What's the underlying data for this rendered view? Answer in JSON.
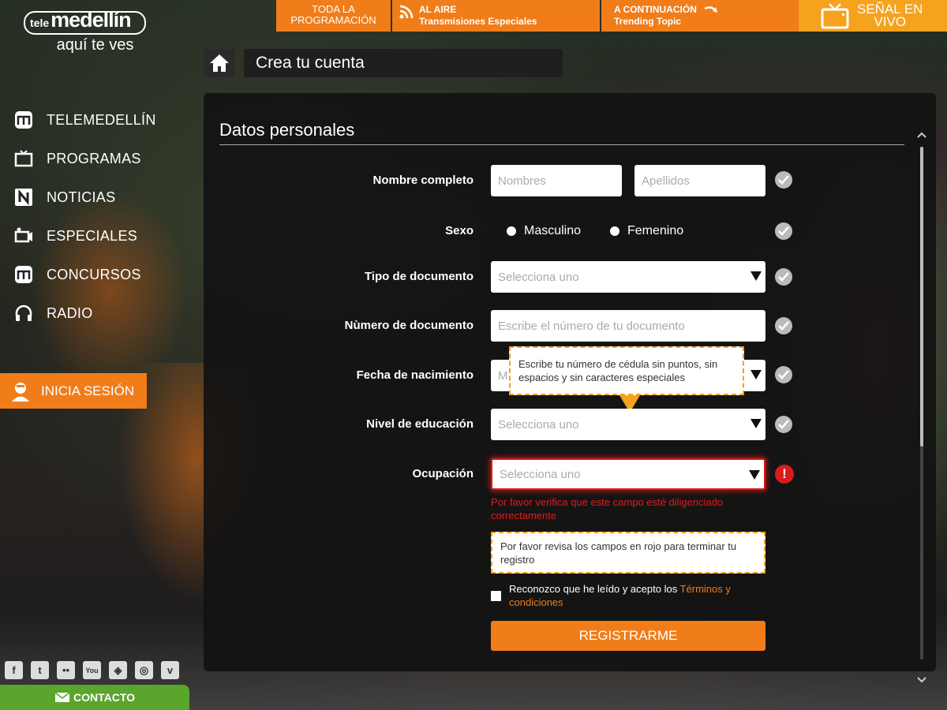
{
  "logo": {
    "tele": "tele",
    "brand": "medellín",
    "tagline": "aquí te ves"
  },
  "topbar": {
    "programacion": "TODA LA PROGRAMACIÓN",
    "aire_title": "AL AIRE",
    "aire_sub": "Transmisiones Especiales",
    "cont_title": "A CONTINUACIÓN",
    "cont_sub": "Trending Topic",
    "senal_line1": "SEÑAL EN",
    "senal_line2": "VIVO"
  },
  "nav": {
    "items": [
      {
        "label": "TELEMEDELLÍN",
        "icon": "m-logo-icon"
      },
      {
        "label": "PROGRAMAS",
        "icon": "tv-icon"
      },
      {
        "label": "NOTICIAS",
        "icon": "n-logo-icon"
      },
      {
        "label": "ESPECIALES",
        "icon": "camera-icon"
      },
      {
        "label": "CONCURSOS",
        "icon": "m-logo-icon"
      },
      {
        "label": "RADIO",
        "icon": "headphones-icon"
      }
    ],
    "login": "INICIA SESIÓN"
  },
  "social": {
    "contact": "CONTACTO"
  },
  "breadcrumb": {
    "title": "Crea tu cuenta"
  },
  "form": {
    "section_title": "Datos personales",
    "nombre": {
      "label": "Nombre completo",
      "first_placeholder": "Nombres",
      "last_placeholder": "Apellidos"
    },
    "sexo": {
      "label": "Sexo",
      "opt1": "Masculino",
      "opt2": "Femenino"
    },
    "tipo_doc": {
      "label": "Tipo de documento",
      "value": "Selecciona uno"
    },
    "num_doc": {
      "label": "Nùmero de documento",
      "placeholder": "Escribe el número de tu documento"
    },
    "fecha": {
      "label": "Fecha de nacimiento",
      "value": "M"
    },
    "educacion": {
      "label": "Nivel de educación",
      "value": "Selecciona uno"
    },
    "ocupacion": {
      "label": "Ocupación",
      "value": "Selecciona uno"
    },
    "tooltip": "Escribe tu número de cédula sin puntos, sin espacios y sin caracteres especiales",
    "error": "Por favor verifica que este campo esté diligenciado correctamente",
    "notice": "Por favor revisa los campos en rojo para terminar tu registro",
    "terms_prefix": "Reconozco que he leído y acepto los ",
    "terms_link": "Términos y condiciones",
    "submit": "REGISTRARME"
  },
  "colors": {
    "accent": "#f07d1a",
    "accent_light": "#f5a21e",
    "error": "#d81b1b",
    "contact": "#5aa52c"
  }
}
